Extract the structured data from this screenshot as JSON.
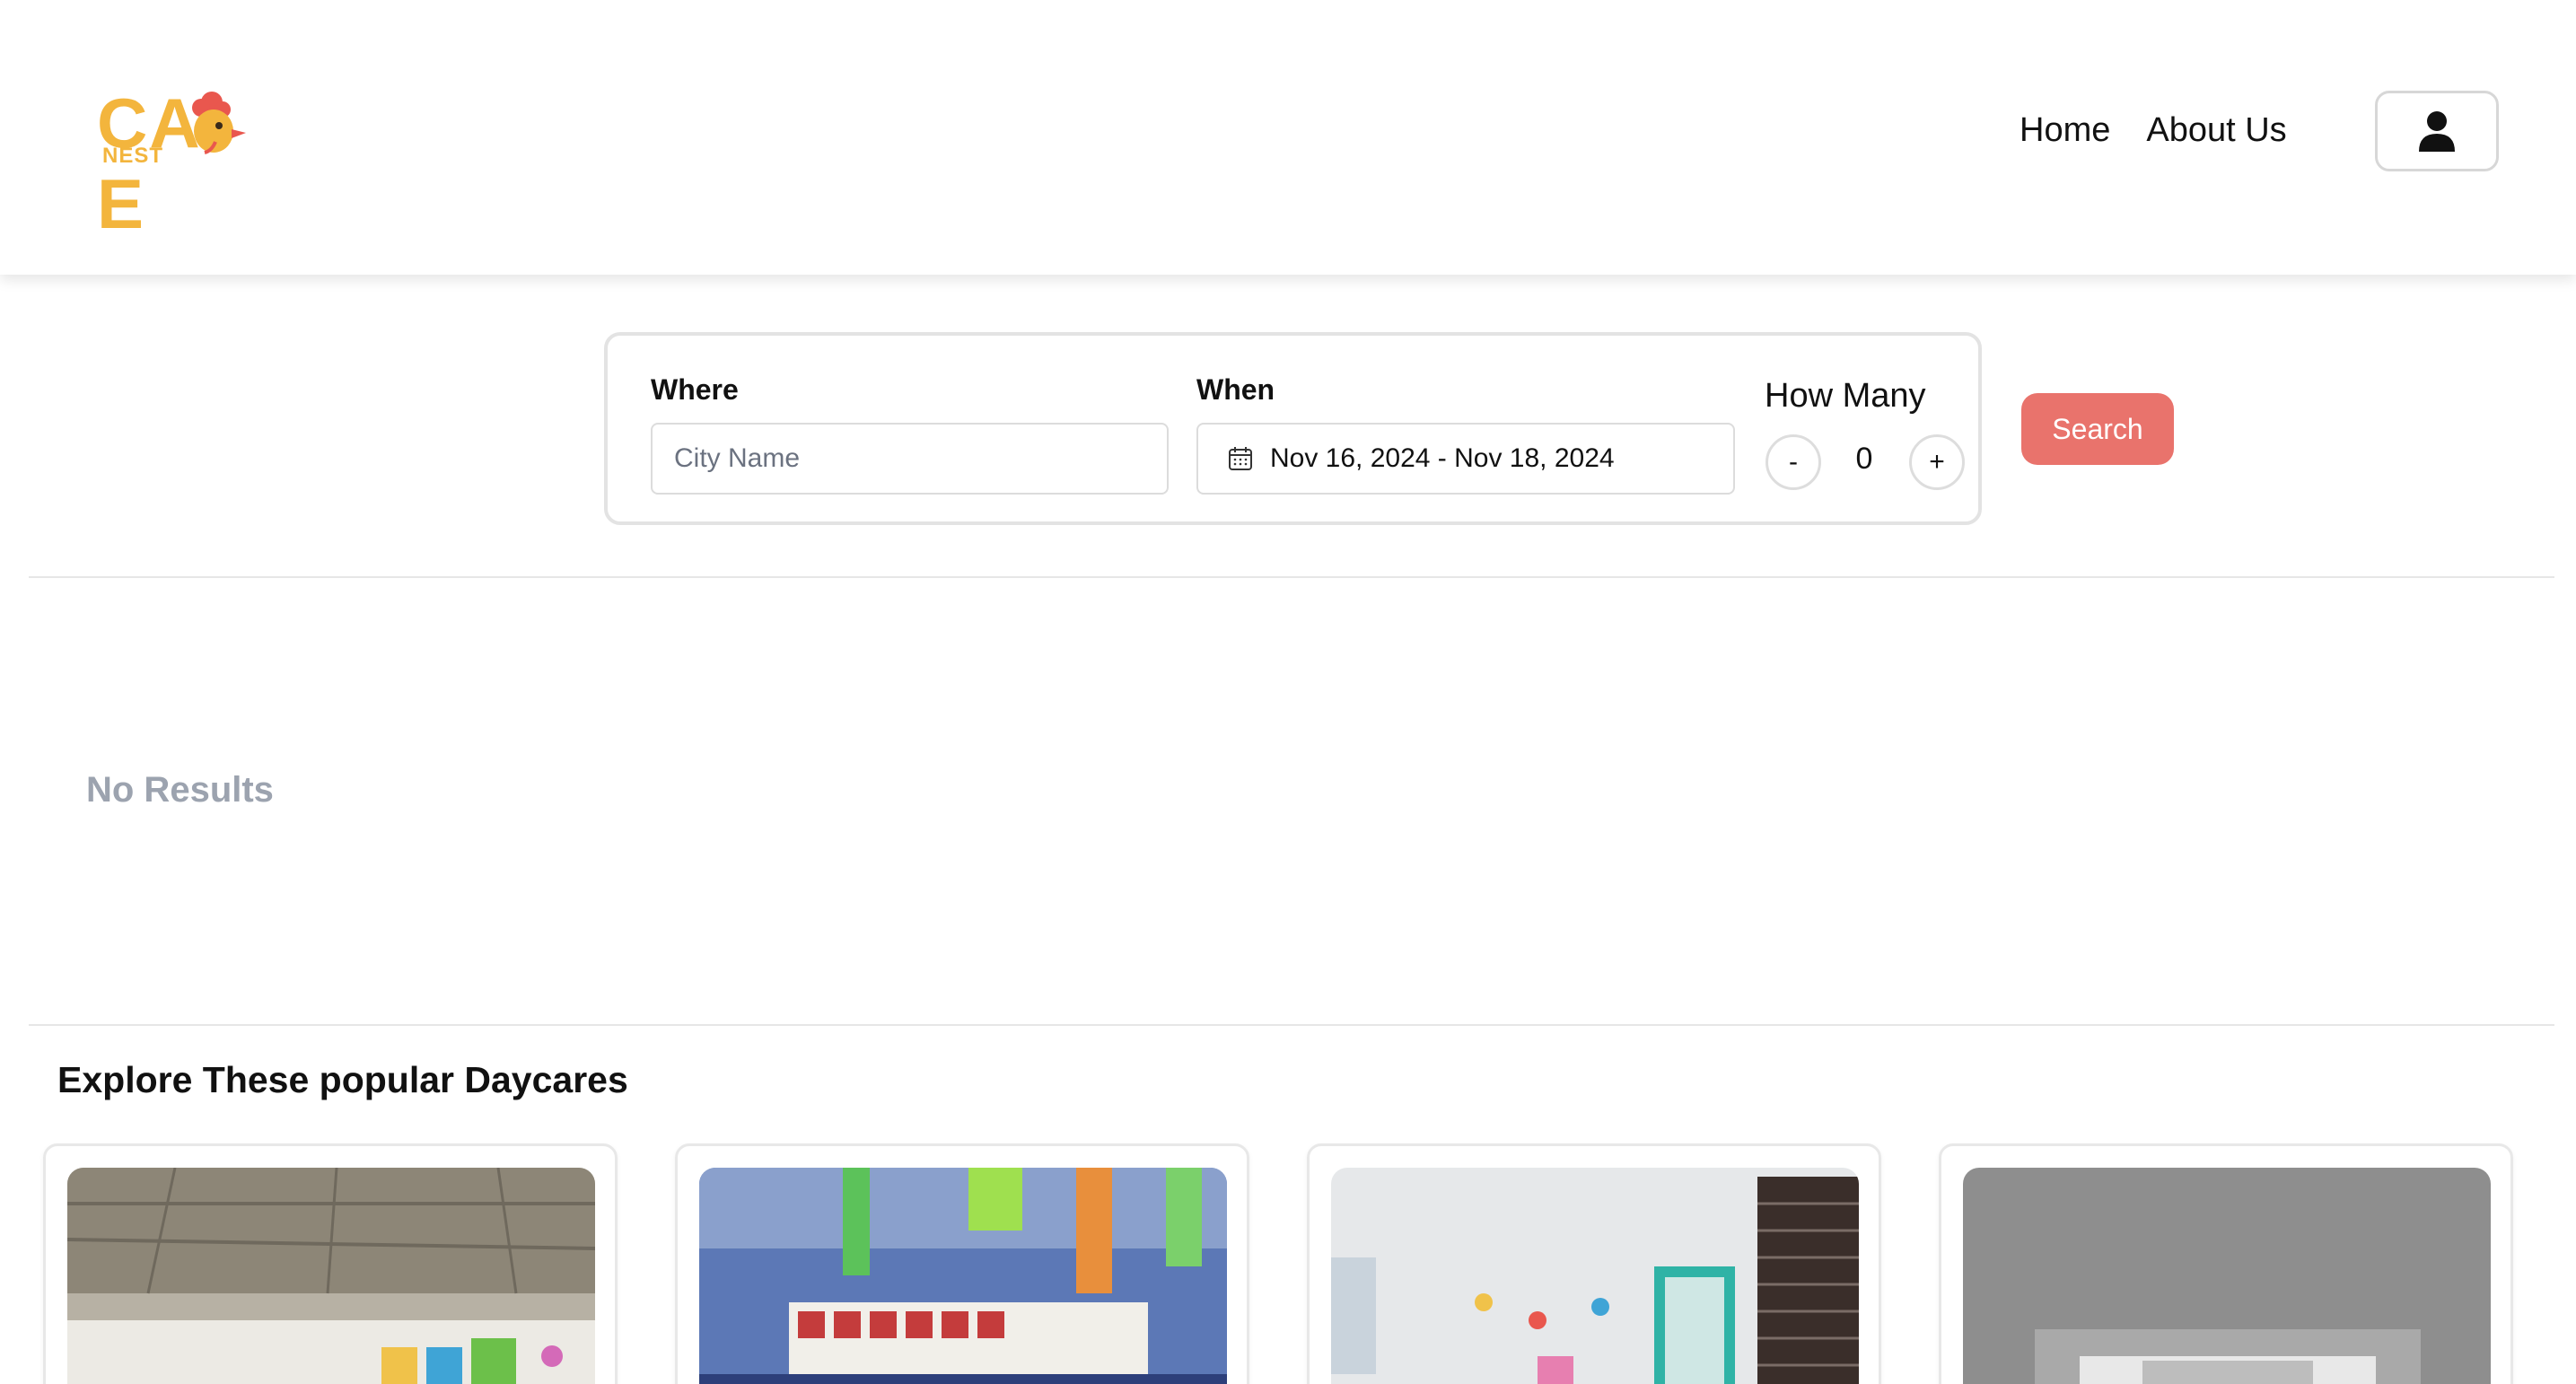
{
  "header": {
    "logo": {
      "main_text": "CARE",
      "sub_text": "NEST",
      "icon": "rooster-icon"
    },
    "nav": [
      {
        "label": "Home"
      },
      {
        "label": "About Us"
      }
    ],
    "user_icon": "user-icon"
  },
  "search": {
    "where_label": "Where",
    "where_placeholder": "City Name",
    "when_label": "When",
    "date_range": "Nov 16, 2024 - Nov 18, 2024",
    "calendar_icon": "calendar-icon",
    "how_many_label": "How Many",
    "decrement_label": "-",
    "count": "0",
    "increment_label": "+",
    "search_label": "Search"
  },
  "results": {
    "empty_text": "No Results"
  },
  "popular": {
    "title": "Explore These popular Daycares"
  },
  "colors": {
    "brand_yellow": "#f3b53d",
    "brand_red": "#e9736c",
    "muted_text": "#9ca3af"
  }
}
